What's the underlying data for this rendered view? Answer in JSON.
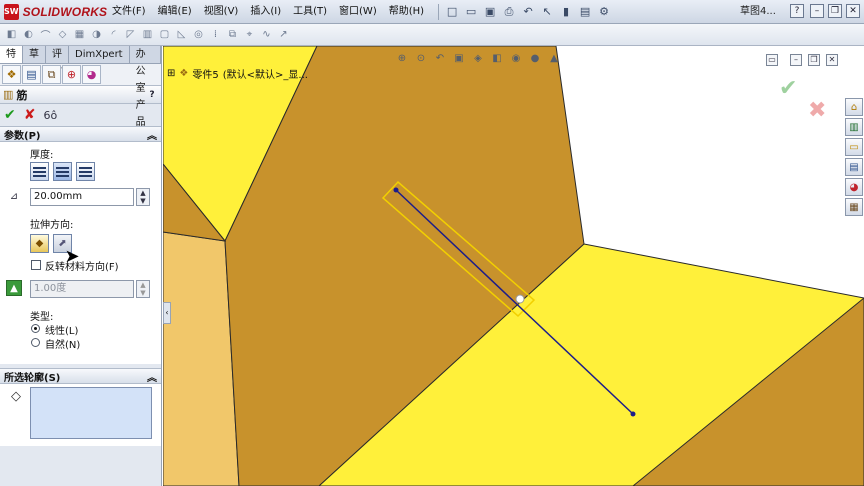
{
  "app": {
    "logo_text": "SOLIDWORKS",
    "document_title": "草图4..."
  },
  "menu": [
    "文件(F)",
    "编辑(E)",
    "视图(V)",
    "插入(I)",
    "工具(T)",
    "窗口(W)",
    "帮助(H)"
  ],
  "tabs": [
    "特征",
    "草图",
    "评估",
    "DimXpert",
    "办公室产品"
  ],
  "property_manager": {
    "title": "筋",
    "help": "?",
    "parameters": {
      "header": "参数(P)",
      "thickness_label": "厚度:",
      "thickness_value": "20.00mm",
      "extrusion_direction_label": "拉伸方向:",
      "flip_material_label": "反转材料方向(F)",
      "flip_material_checked": false,
      "draft_value": "1.00度",
      "type_label": "类型:",
      "type_options": [
        "线性(L)",
        "自然(N)"
      ],
      "type_selected": "线性(L)"
    },
    "selected_contours": {
      "header": "所选轮廓(S)"
    }
  },
  "feature_tree": {
    "part_name": "零件5",
    "config": "(默认<默认>_显..."
  },
  "colors": {
    "face_light": "#fff03a",
    "face_dark": "#c8922c",
    "face_side": "#f1c76a",
    "sketch_line": "#1d1d8a",
    "rib_preview": "#f2d000"
  }
}
